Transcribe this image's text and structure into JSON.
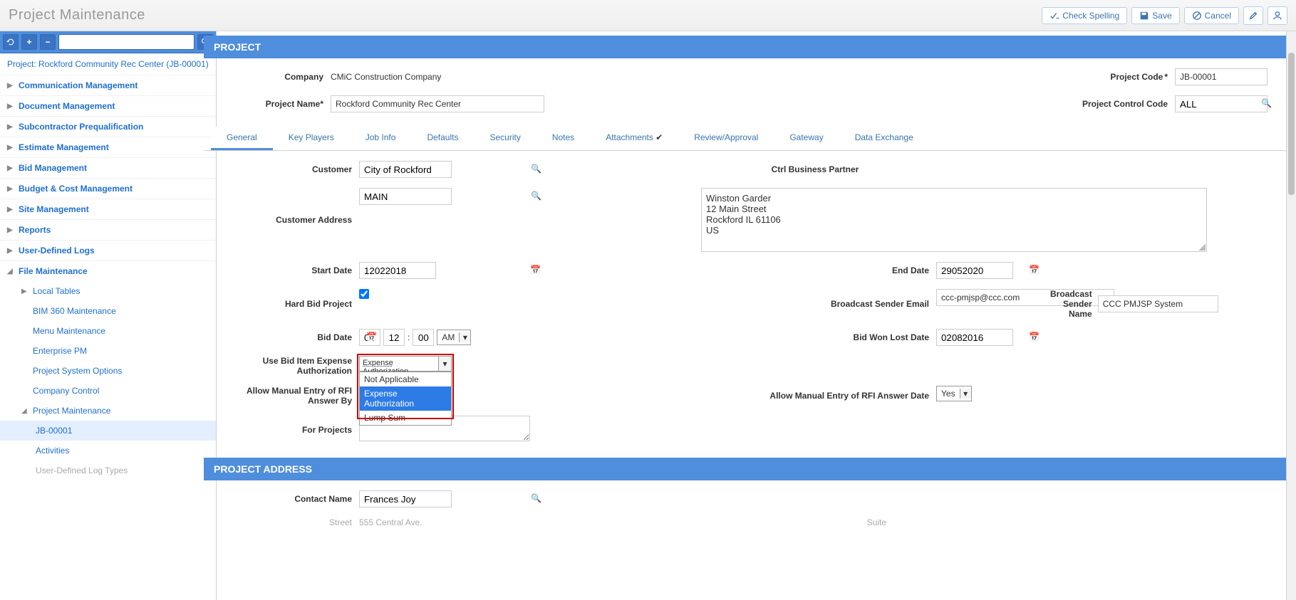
{
  "header": {
    "title": "Project Maintenance",
    "check_spelling": "Check Spelling",
    "save": "Save",
    "cancel": "Cancel"
  },
  "sidebar": {
    "project_link": "Project: Rockford Community Rec Center (JB-00001)",
    "items": [
      {
        "label": "Communication Management",
        "expanded": false
      },
      {
        "label": "Document Management",
        "expanded": false
      },
      {
        "label": "Subcontractor Prequalification",
        "expanded": false
      },
      {
        "label": "Estimate Management",
        "expanded": false
      },
      {
        "label": "Bid Management",
        "expanded": false
      },
      {
        "label": "Budget & Cost Management",
        "expanded": false
      },
      {
        "label": "Site Management",
        "expanded": false
      },
      {
        "label": "Reports",
        "expanded": false
      },
      {
        "label": "User-Defined Logs",
        "expanded": false
      },
      {
        "label": "File Maintenance",
        "expanded": true,
        "children": [
          {
            "label": "Local Tables",
            "level": 2,
            "caret": true
          },
          {
            "label": "BIM 360 Maintenance",
            "level": 2
          },
          {
            "label": "Menu Maintenance",
            "level": 2
          },
          {
            "label": "Enterprise PM",
            "level": 2
          },
          {
            "label": "Project System Options",
            "level": 2
          },
          {
            "label": "Company Control",
            "level": 2
          },
          {
            "label": "Project Maintenance",
            "level": 2,
            "caret": true,
            "expanded": true,
            "children": [
              {
                "label": "JB-00001",
                "selected": true
              },
              {
                "label": "Activities"
              },
              {
                "label": "User-Defined Log Types",
                "dim": true
              }
            ]
          }
        ]
      }
    ]
  },
  "project": {
    "section": "PROJECT",
    "company_label": "Company",
    "company_value": "CMiC Construction Company",
    "project_name_label": "Project Name*",
    "project_name_value": "Rockford Community Rec Center",
    "project_code_label": "Project Code",
    "project_code_value": "JB-00001",
    "control_code_label": "Project Control Code",
    "control_code_value": "ALL"
  },
  "tabs": [
    "General",
    "Key Players",
    "Job Info",
    "Defaults",
    "Security",
    "Notes",
    "Attachments",
    "Review/Approval",
    "Gateway",
    "Data Exchange"
  ],
  "general": {
    "customer_label": "Customer",
    "customer_value": "City of Rockford",
    "ctrl_bp_label": "Ctrl Business Partner",
    "customer_addr_label": "Customer Address",
    "customer_addr_value": "MAIN",
    "address_text": "Winston Garder\n12 Main Street\nRockford IL 61106\nUS",
    "start_date_label": "Start Date",
    "start_date_value": "12022018",
    "end_date_label": "End Date",
    "end_date_value": "29052020",
    "hard_bid_label": "Hard Bid Project",
    "hard_bid_checked": true,
    "bcast_email_label": "Broadcast Sender Email",
    "bcast_email_value": "ccc-pmjsp@ccc.com",
    "bcast_name_label": "Broadcast Sender Name",
    "bcast_name_value": "CCC PMJSP System",
    "bid_date_label": "Bid Date",
    "bid_date_value": "04112016",
    "bid_hour": "12",
    "bid_min": "00",
    "bid_ampm": "AM",
    "bid_wonlost_label": "Bid Won Lost Date",
    "bid_wonlost_value": "02082016",
    "use_bid_item_label": "Use Bid Item Expense Authorization",
    "use_bid_item_value": "Expense Authorization",
    "use_bid_item_options": [
      "Not Applicable",
      "Expense Authorization",
      "Lump Sum"
    ],
    "allow_rfi_by_label": "Allow Manual Entry of RFI Answer By",
    "allow_rfi_date_label": "Allow Manual Entry of RFI Answer Date",
    "allow_rfi_date_value": "Yes",
    "for_projects_label": "For Projects"
  },
  "project_address": {
    "section": "PROJECT ADDRESS",
    "contact_label": "Contact Name",
    "contact_value": "Frances Joy",
    "street_label": "Street",
    "street_value": "555 Central Ave.",
    "suite_label": "Suite"
  }
}
